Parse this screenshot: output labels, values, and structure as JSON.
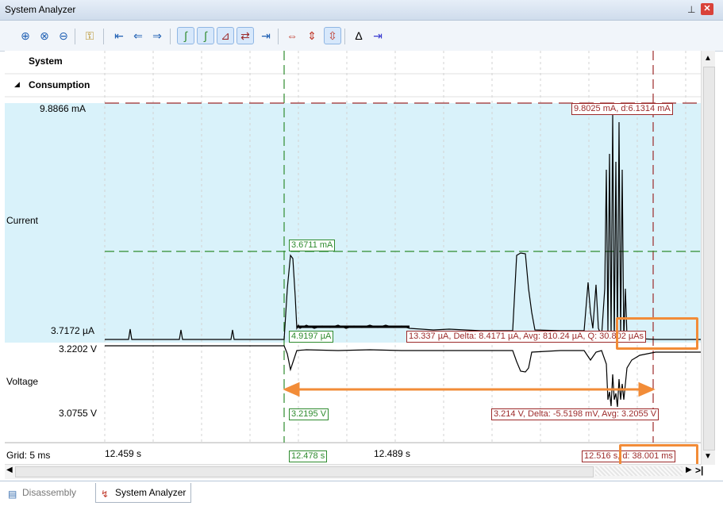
{
  "window": {
    "title": "System Analyzer",
    "pin_glyph": "⊥",
    "close_glyph": "✕"
  },
  "toolbar": {
    "buttons": [
      {
        "name": "zoom-in-icon",
        "glyph": "⊕"
      },
      {
        "name": "zoom-fit-icon",
        "glyph": "⊗"
      },
      {
        "name": "zoom-out-icon",
        "glyph": "⊖"
      },
      {
        "name": "lock-icon",
        "glyph": "🔓"
      },
      {
        "name": "go-first-icon",
        "glyph": "⇤"
      },
      {
        "name": "go-previous-icon",
        "glyph": "⇐"
      },
      {
        "name": "go-next-icon",
        "glyph": "⇒"
      },
      {
        "name": "rising-edge-icon",
        "glyph": "∫"
      },
      {
        "name": "falling-edge-icon",
        "glyph": "∫"
      },
      {
        "name": "edge-marker-icon",
        "glyph": "⊿"
      },
      {
        "name": "marker-toggle-icon",
        "glyph": "⇄"
      },
      {
        "name": "align-icon",
        "glyph": "⇥"
      },
      {
        "name": "expand-horizontal-icon",
        "glyph": "⇔"
      },
      {
        "name": "expand-vertical-icon",
        "glyph": "⇕"
      },
      {
        "name": "auto-scale-icon",
        "glyph": "⇳"
      },
      {
        "name": "delta-icon",
        "glyph": "Δ"
      },
      {
        "name": "go-last-icon",
        "glyph": "⇥"
      }
    ]
  },
  "panel": {
    "system_label": "System",
    "consumption_label": "Consumption",
    "current_label": "Current",
    "voltage_label": "Voltage",
    "current_max": "9.8866 mA",
    "current_min": "3.7172 µA",
    "voltage_max": "3.2202 V",
    "voltage_min": "3.0755 V",
    "grid_label": "Grid: 5 ms"
  },
  "markers": {
    "red_top": "9.8025 mA, d:6.1314 mA",
    "green_current": "3.6711 mA",
    "green_low": "4.9197 µA",
    "red_current_stats": "13.337 µA, Delta: 8.4171 µA, Avg: 810.24 µA, Q: 30.802 µAs",
    "green_voltage": "3.2195 V",
    "red_voltage_stats": "3.214 V, Delta: -5.5198 mV, Avg: 3.2055 V",
    "green_time": "12.478 s",
    "red_time": "12.516 s, d: 38.001 ms"
  },
  "time_axis": {
    "ticks": [
      "12.459 s",
      "12.489 s"
    ]
  },
  "colors": {
    "current_bg": "#d9f2fa",
    "green_marker": "#2e8b2e",
    "red_marker": "#9c2a2a",
    "highlight": "#f28c38",
    "arrow": "#f28c38"
  },
  "bottom_tabs": [
    {
      "label": "Disassembly",
      "active": false
    },
    {
      "label": "System Analyzer",
      "active": true
    }
  ]
}
